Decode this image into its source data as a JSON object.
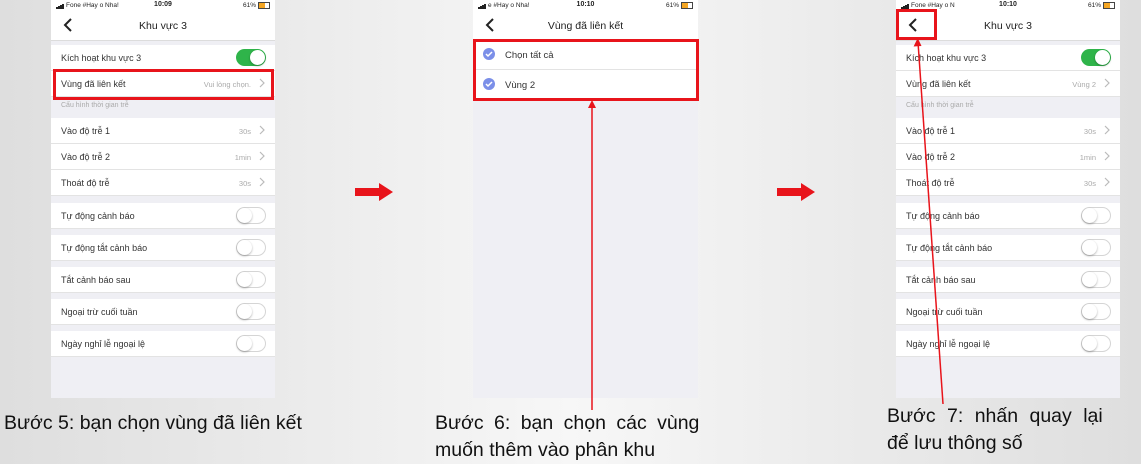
{
  "status_left_1": "Fone #Hay o Nha!",
  "status_left_2": "e #Hay o Nha!",
  "status_left_3": "Fone #Hay o N",
  "status_time_1": "10:09",
  "status_time_2": "10:10",
  "status_time_3": "10:10",
  "status_battery": "61%",
  "screen1": {
    "title": "Khu vực 3",
    "activate_label": "Kích hoạt khu vực 3",
    "linked_label": "Vùng đã liên kết",
    "linked_value": "Vui lòng chọn.",
    "section": "Cấu hình thời gian trễ",
    "delay_in_1": "Vào độ trễ 1",
    "delay_in_1_val": "30s",
    "delay_in_2": "Vào độ trễ 2",
    "delay_in_2_val": "1min",
    "exit_delay": "Thoát độ trễ",
    "exit_delay_val": "30s",
    "auto_alarm": "Tự động cảnh báo",
    "auto_off_alarm": "Tự động tắt cảnh báo",
    "off_alarm_after": "Tắt cảnh báo sau",
    "except_weekend": "Ngoại trừ cuối tuần",
    "holiday_exception": "Ngày nghỉ lễ ngoại lệ"
  },
  "screen2": {
    "title": "Vùng đã liên kết",
    "select_all": "Chọn tất cả",
    "zone_2": "Vùng 2"
  },
  "screen3": {
    "title": "Khu vực 3",
    "activate_label": "Kích hoạt khu vực 3",
    "linked_label": "Vùng đã liên kết",
    "linked_value": "Vùng 2",
    "section": "Cấu hình thời gian trễ",
    "delay_in_1": "Vào độ trễ 1",
    "delay_in_1_val": "30s",
    "delay_in_2": "Vào độ trễ 2",
    "delay_in_2_val": "1min",
    "exit_delay": "Thoát độ trễ",
    "exit_delay_val": "30s",
    "auto_alarm": "Tự động cảnh báo",
    "auto_off_alarm": "Tự động tắt cảnh báo",
    "off_alarm_after": "Tắt cảnh báo sau",
    "except_weekend": "Ngoại trừ cuối tuần",
    "holiday_exception": "Ngày nghỉ lễ ngoại lệ"
  },
  "captions": {
    "step5": "Bước 5: bạn chọn vùng đã liên kết",
    "step6_line1": "Bước 6: bạn chọn các vùng",
    "step6_line2": "muốn thêm vào phân khu",
    "step7_line1": "Bước 7: nhấn quay lại",
    "step7_line2": "để lưu thông số"
  },
  "colors": {
    "highlight": "#e8141b",
    "toggle_on": "#2fb44a",
    "checkbox": "#7b8fe8"
  }
}
